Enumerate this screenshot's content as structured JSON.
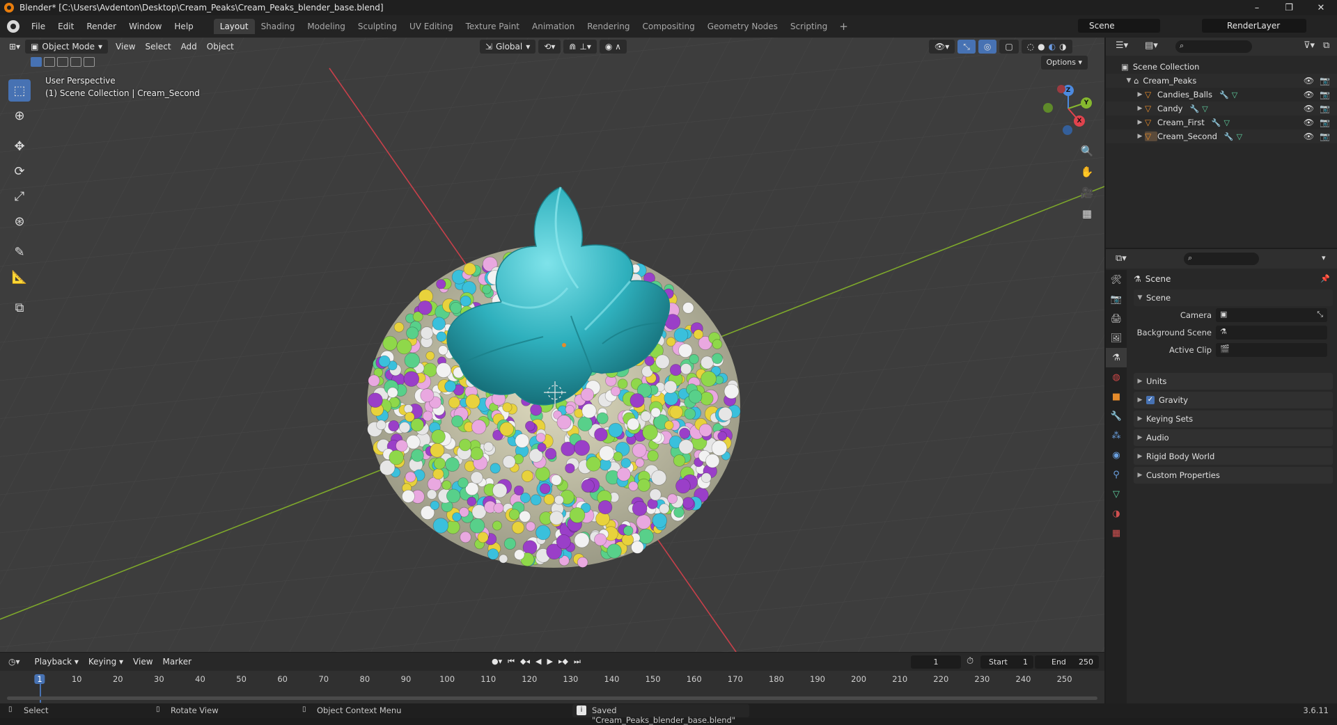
{
  "window": {
    "title": "Blender* [C:\\Users\\Avdenton\\Desktop\\Cream_Peaks\\Cream_Peaks_blender_base.blend]",
    "controls": [
      "–",
      "❐",
      "✕"
    ]
  },
  "menu": [
    "File",
    "Edit",
    "Render",
    "Window",
    "Help"
  ],
  "workspaces": {
    "active": "Layout",
    "tabs": [
      "Layout",
      "Shading",
      "Modeling",
      "Sculpting",
      "UV Editing",
      "Texture Paint",
      "Animation",
      "Rendering",
      "Compositing",
      "Geometry Nodes",
      "Scripting"
    ],
    "add": "+"
  },
  "scene_selector": {
    "scene": "Scene",
    "view_layer": "RenderLayer"
  },
  "viewport": {
    "mode": "Object Mode",
    "menus": [
      "View",
      "Select",
      "Add",
      "Object"
    ],
    "orientation": "Global",
    "view_name": "User Perspective",
    "collection_info": "(1) Scene Collection | Cream_Second",
    "options_label": "Options",
    "gizmo": {
      "z": "Z",
      "y": "Y",
      "x": "X"
    }
  },
  "outliner": {
    "root": "Scene Collection",
    "collection": "Cream_Peaks",
    "objects": [
      "Candies_Balls",
      "Candy",
      "Cream_First",
      "Cream_Second"
    ]
  },
  "properties": {
    "context_title": "Scene",
    "panel_title": "Scene",
    "fields": [
      {
        "label": "Camera"
      },
      {
        "label": "Background Scene"
      },
      {
        "label": "Active Clip"
      }
    ],
    "sections": [
      "Units",
      "Gravity",
      "Keying Sets",
      "Audio",
      "Rigid Body World",
      "Custom Properties"
    ],
    "gravity_enabled": true
  },
  "timeline": {
    "menus": [
      "Playback",
      "Keying",
      "View",
      "Marker"
    ],
    "current_frame": "1",
    "start_label": "Start",
    "start": "1",
    "end_label": "End",
    "end": "250",
    "ruler": [
      "1",
      "10",
      "20",
      "30",
      "40",
      "50",
      "60",
      "70",
      "80",
      "90",
      "100",
      "110",
      "120",
      "130",
      "140",
      "150",
      "160",
      "170",
      "180",
      "190",
      "200",
      "210",
      "220",
      "230",
      "240",
      "250"
    ]
  },
  "statusbar": {
    "select": "Select",
    "rotate": "Rotate View",
    "context": "Object Context Menu",
    "message": "Saved \"Cream_Peaks_blender_base.blend\"",
    "version": "3.6.11"
  },
  "colors": {
    "accent": "#4772b3",
    "object_orange": "#e58b2b",
    "axis_x": "#e0434d",
    "axis_y": "#86b82f",
    "axis_z": "#4c8ae0",
    "cream": "#35b5c0"
  }
}
